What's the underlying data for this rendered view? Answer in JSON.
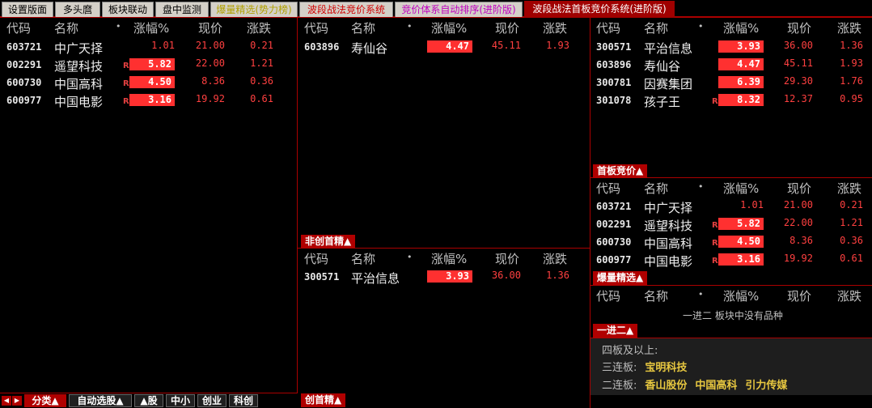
{
  "tabs": [
    {
      "label": "设置版面"
    },
    {
      "label": "多头麿"
    },
    {
      "label": "板块联动"
    },
    {
      "label": "盘中监测"
    },
    {
      "label": "爆量精选(势力榜)"
    },
    {
      "label": "波段战法竞价系统"
    },
    {
      "label": "竞价体系自动排序(进阶版)"
    },
    {
      "label": "波段战法首板竞价系统(进阶版)"
    }
  ],
  "headers": {
    "code": "代码",
    "name": "名称",
    "dot": "•",
    "change": "涨幅%",
    "price": "现价",
    "diff": "涨跌"
  },
  "panel_left": {
    "rows": [
      {
        "code": "603721",
        "name": "中广天择",
        "r": "",
        "change": "1.01",
        "price": "21.00",
        "diff": "0.21",
        "boxed": false
      },
      {
        "code": "002291",
        "name": "遥望科技",
        "r": "R",
        "change": "5.82",
        "price": "22.00",
        "diff": "1.21",
        "boxed": true
      },
      {
        "code": "600730",
        "name": "中国高科",
        "r": "R",
        "change": "4.50",
        "price": "8.36",
        "diff": "0.36",
        "boxed": true
      },
      {
        "code": "600977",
        "name": "中国电影",
        "r": "R",
        "change": "3.16",
        "price": "19.92",
        "diff": "0.61",
        "boxed": true
      }
    ]
  },
  "panel_mid_top": {
    "rows": [
      {
        "code": "603896",
        "name": "寿仙谷",
        "r": "",
        "change": "4.47",
        "price": "45.11",
        "diff": "1.93",
        "boxed": true
      }
    ],
    "label": "非创首精▲"
  },
  "panel_mid_bottom": {
    "rows": [
      {
        "code": "300571",
        "name": "平治信息",
        "r": "",
        "change": "3.93",
        "price": "36.00",
        "diff": "1.36",
        "boxed": true
      }
    ],
    "label": "创首精▲"
  },
  "panel_right_top": {
    "rows": [
      {
        "code": "300571",
        "name": "平治信息",
        "r": "",
        "change": "3.93",
        "price": "36.00",
        "diff": "1.36",
        "boxed": true
      },
      {
        "code": "603896",
        "name": "寿仙谷",
        "r": "",
        "change": "4.47",
        "price": "45.11",
        "diff": "1.93",
        "boxed": true
      },
      {
        "code": "300781",
        "name": "因赛集团",
        "r": "",
        "change": "6.39",
        "price": "29.30",
        "diff": "1.76",
        "boxed": true
      },
      {
        "code": "301078",
        "name": "孩子王",
        "r": "R",
        "change": "8.32",
        "price": "12.37",
        "diff": "0.95",
        "boxed": true
      }
    ],
    "label": "首板竞价▲"
  },
  "panel_right_mid": {
    "rows": [
      {
        "code": "603721",
        "name": "中广天择",
        "r": "",
        "change": "1.01",
        "price": "21.00",
        "diff": "0.21",
        "boxed": false
      },
      {
        "code": "002291",
        "name": "遥望科技",
        "r": "R",
        "change": "5.82",
        "price": "22.00",
        "diff": "1.21",
        "boxed": true
      },
      {
        "code": "600730",
        "name": "中国高科",
        "r": "R",
        "change": "4.50",
        "price": "8.36",
        "diff": "0.36",
        "boxed": true
      },
      {
        "code": "600977",
        "name": "中国电影",
        "r": "R",
        "change": "3.16",
        "price": "19.92",
        "diff": "0.61",
        "boxed": true
      }
    ],
    "label": "爆量精选▲"
  },
  "panel_right_yijin": {
    "empty_msg": "一进二 板块中没有品种",
    "label": "一进二▲"
  },
  "lianban": {
    "line1": "四板及以上:",
    "line2_label": "三连板:",
    "line2_stocks": [
      "宝明科技"
    ],
    "line3_label": "二连板:",
    "line3_stocks": [
      "香山股份",
      "中国高科",
      "引力传媒"
    ]
  },
  "bottombar": {
    "items": [
      "分类▲",
      "自动选股▲",
      "▲股",
      "中小",
      "创业",
      "科创"
    ]
  },
  "colors": {
    "up": "#ff3030",
    "accent": "#b00000",
    "bg": "#000000"
  }
}
